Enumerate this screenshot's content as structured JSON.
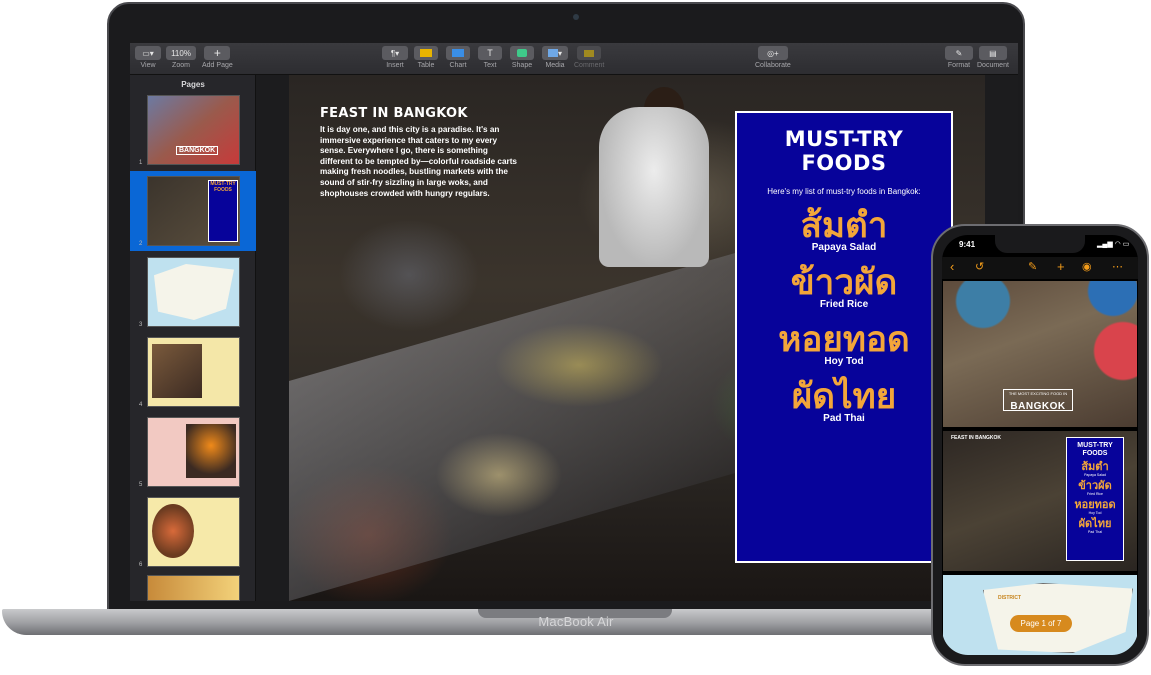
{
  "laptop": {
    "brand_label": "MacBook Air",
    "toolbar": {
      "view": "View",
      "zoom_value": "110%",
      "zoom": "Zoom",
      "add_page": "Add Page",
      "insert": "Insert",
      "table": "Table",
      "chart": "Chart",
      "text": "Text",
      "shape": "Shape",
      "media": "Media",
      "comment": "Comment",
      "collaborate": "Collaborate",
      "format": "Format",
      "document": "Document"
    },
    "sidebar": {
      "title": "Pages",
      "thumbnails": [
        {
          "num": "1",
          "caption": "BANGKOK"
        },
        {
          "num": "2",
          "caption": "MUST-TRY FOODS"
        },
        {
          "num": "3",
          "caption": ""
        },
        {
          "num": "4",
          "caption": ""
        },
        {
          "num": "5",
          "caption": ""
        },
        {
          "num": "6",
          "caption": ""
        },
        {
          "num": "7",
          "caption": ""
        }
      ],
      "selected_index": 1
    },
    "document": {
      "feast_title": "FEAST IN BANGKOK",
      "feast_body": "It is day one, and this city is a paradise. It's an immersive experience that caters to my every sense. Everywhere I go, there is something different to be tempted by—colorful roadside carts making fresh noodles, bustling markets with the sound of stir-fry sizzling in large woks, and shophouses crowded with hungry regulars.",
      "must_title_line1": "MUST-TRY",
      "must_title_line2": "FOODS",
      "must_intro": "Here's my list of must-try foods in Bangkok:",
      "foods": [
        {
          "thai": "ส้มตำ",
          "english": "Papaya Salad"
        },
        {
          "thai": "ข้าวผัด",
          "english": "Fried Rice"
        },
        {
          "thai": "หอยทอด",
          "english": "Hoy Tod"
        },
        {
          "thai": "ผัดไทย",
          "english": "Pad Thai"
        }
      ]
    }
  },
  "phone": {
    "time": "9:41",
    "status_icons": "▂▄▆ ◠ ▭",
    "icons": [
      "chevron-left-icon",
      "undo-icon",
      "brush-icon",
      "plus-icon",
      "collaborate-icon",
      "more-icon"
    ],
    "cover_subtitle": "THE MOST EXCITING FOOD IN",
    "cover_title": "BANGKOK",
    "feast_title": "FEAST IN BANGKOK",
    "must_title_line1": "MUST-TRY",
    "must_title_line2": "FOODS",
    "foods_thai": [
      "ส้มตำ",
      "ข้าวผัด",
      "หอยทอด",
      "ผัดไทย"
    ],
    "foods_english": [
      "Papaya Salad",
      "Fried Rice",
      "Hoy Tod",
      "Pad Thai"
    ],
    "page_indicator": "Page 1 of 7",
    "map_label": "DISTRICT"
  },
  "colors": {
    "must_bg": "#07039a",
    "thai_text": "#f3a63a",
    "selection": "#0a67d6",
    "phone_accent": "#f39c1a",
    "page_pill": "#d78a1e"
  }
}
